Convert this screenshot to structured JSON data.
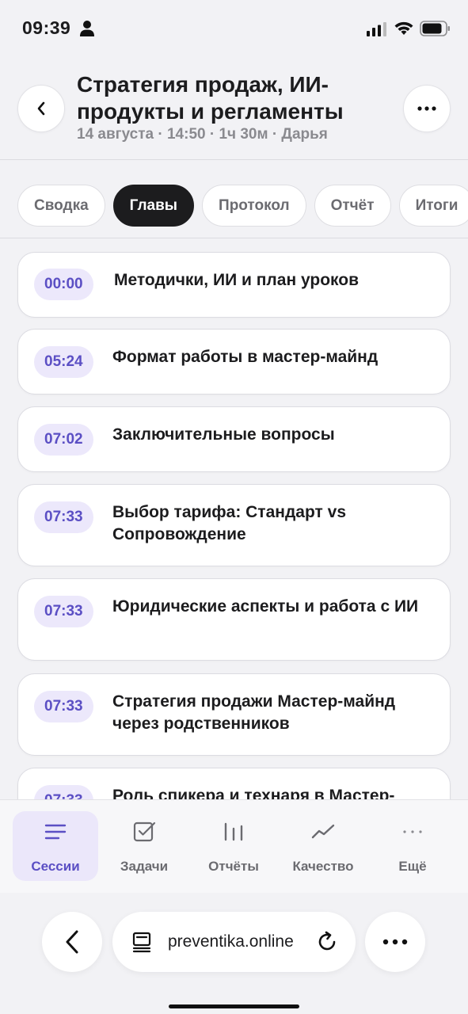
{
  "status_bar": {
    "time": "09:39"
  },
  "header": {
    "title": "Стратегия продаж, ИИ-продукты и регламенты",
    "meta": "14 августа · 14:50 · 1ч 30м · Дарья"
  },
  "tabs": [
    {
      "label": "Сводка",
      "active": false
    },
    {
      "label": "Главы",
      "active": true
    },
    {
      "label": "Протокол",
      "active": false
    },
    {
      "label": "Отчёт",
      "active": false
    },
    {
      "label": "Итоги",
      "active": false
    }
  ],
  "chapters": [
    {
      "time": "00:00",
      "title": "Методички, ИИ и план уроков"
    },
    {
      "time": "05:24",
      "title": "Формат работы в мастер-майнд"
    },
    {
      "time": "07:02",
      "title": "Заключительные вопросы"
    },
    {
      "time": "07:33",
      "title": "Выбор тарифа: Стандарт vs Сопровождение"
    },
    {
      "time": "07:33",
      "title": "Юридические аспекты и работа с ИИ"
    },
    {
      "time": "07:33",
      "title": "Стратегия продажи Мастер-майнд через родственников"
    },
    {
      "time": "07:33",
      "title": "Роль спикера и технаря в Мастер-майнд"
    }
  ],
  "bottom_nav": [
    {
      "label": "Сессии",
      "icon": "menu-lines-icon",
      "active": true
    },
    {
      "label": "Задачи",
      "icon": "checkbox-icon",
      "active": false
    },
    {
      "label": "Отчёты",
      "icon": "bar-chart-icon",
      "active": false
    },
    {
      "label": "Качество",
      "icon": "trend-line-icon",
      "active": false
    },
    {
      "label": "Ещё",
      "icon": "more-dots-icon",
      "active": false
    }
  ],
  "browser": {
    "url": "preventika.online"
  },
  "colors": {
    "accent": "#5b4fc4",
    "accent_bg": "#ece8fb",
    "active_tab": "#1c1c1e"
  }
}
